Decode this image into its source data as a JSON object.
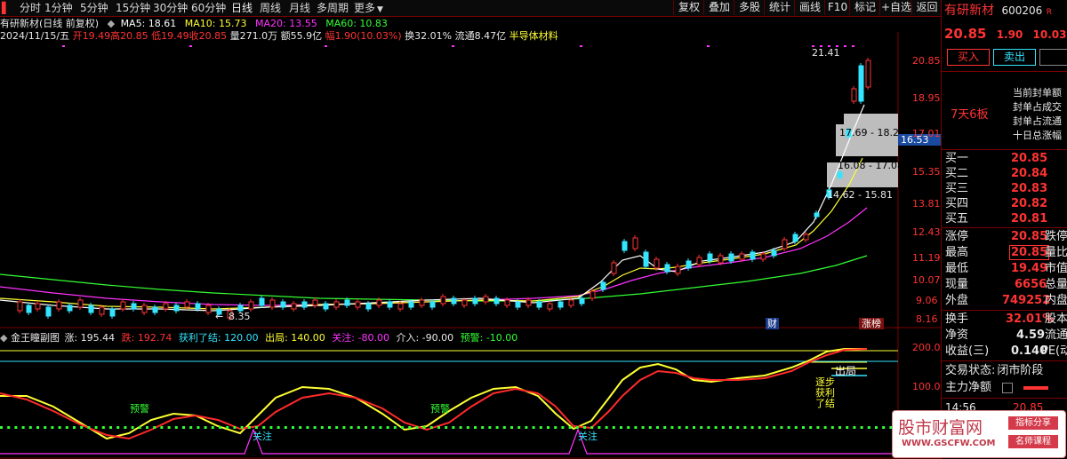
{
  "toolbar": {
    "periods": [
      "分时",
      "1分钟",
      "5分钟",
      "15分钟",
      "30分钟",
      "60分钟",
      "日线",
      "周线",
      "月线",
      "多周期",
      "更多"
    ],
    "active_period": "日线",
    "buttons": [
      "复权",
      "叠加",
      "多股",
      "统计",
      "画线",
      "F10",
      "标记",
      "+自选",
      "返回"
    ]
  },
  "header": {
    "title": "有研新材(日线 前复权)",
    "ma": [
      {
        "label": "MA5: 18.61",
        "color": "#ffffff"
      },
      {
        "label": "MA10: 15.73",
        "color": "#ffff33"
      },
      {
        "label": "MA20: 13.55",
        "color": "#ff33ff"
      },
      {
        "label": "MA60: 10.83",
        "color": "#33ff33"
      }
    ],
    "info_date": "2024/11/15/五",
    "info": [
      {
        "text": "开19.49",
        "color": "#ff3333"
      },
      {
        "text": "高20.85",
        "color": "#ff3333"
      },
      {
        "text": "低19.49",
        "color": "#ff3333"
      },
      {
        "text": "收20.85",
        "color": "#ff3333"
      },
      {
        "text": "量271.0万",
        "color": "#e8e8e8"
      },
      {
        "text": "额55.9亿",
        "color": "#e8e8e8"
      },
      {
        "text": "幅1.90(10.03%)",
        "color": "#ff3333"
      },
      {
        "text": "换32.01%",
        "color": "#e8e8e8"
      },
      {
        "text": "流通8.47亿",
        "color": "#e8e8e8"
      },
      {
        "text": "半导体材料",
        "color": "#ffff33"
      }
    ]
  },
  "price_axis": [
    "20.85",
    "18.95",
    "17.01",
    "15.35",
    "13.81",
    "12.43",
    "11.19",
    "10.07",
    "9.06",
    "8.16"
  ],
  "current_price_tag": "16.53",
  "annotations": {
    "high": "21.41",
    "low": "8.35",
    "range1": "17.69 - 18.2",
    "range2": "16.08 - 17.08",
    "range3": "14.62 - 15.81",
    "cai": "财",
    "zhangbang": "涨榜"
  },
  "indicator": {
    "name": "金王瞳副图",
    "values": [
      {
        "text": "涨: 195.44",
        "color": "#e8e8e8"
      },
      {
        "text": "跌: 192.74",
        "color": "#ff3333"
      },
      {
        "text": "获利了结: 120.00",
        "color": "#33e5ff"
      },
      {
        "text": "出局: 140.00",
        "color": "#ffff33"
      },
      {
        "text": "关注: -80.00",
        "color": "#ff33ff"
      },
      {
        "text": "介入: -90.00",
        "color": "#e8e8e8"
      },
      {
        "text": "预警: -10.00",
        "color": "#33ff33"
      }
    ],
    "axis": [
      "200.0",
      "100.0"
    ],
    "labels": {
      "yujing1": "预警",
      "yujing2": "预警",
      "guanzhu1": "关注",
      "guanzhu2": "关注",
      "chuju": "出局",
      "zhubu": "逐步",
      "huoli": "获利",
      "liaojie": "了结"
    }
  },
  "right_panel": {
    "name": "有研新材",
    "code": "600206",
    "code_suffix": "R",
    "price": "20.85",
    "change": "1.90",
    "pct": "10.03%",
    "buy_btn": "买入",
    "sell_btn": "卖出",
    "streak": "7天6板",
    "seal_info": [
      "当前封单额",
      "封单占成交",
      "封单占流通",
      "十日总涨幅"
    ],
    "bids": [
      {
        "label": "买一",
        "price": "20.85"
      },
      {
        "label": "买二",
        "price": "20.84"
      },
      {
        "label": "买三",
        "price": "20.83"
      },
      {
        "label": "买四",
        "price": "20.82"
      },
      {
        "label": "买五",
        "price": "20.81"
      }
    ],
    "stats": [
      {
        "label": "涨停",
        "value": "20.85",
        "label2": "跌停"
      },
      {
        "label": "最高",
        "value": "20.85",
        "label2": "量比"
      },
      {
        "label": "最低",
        "value": "19.49",
        "label2": "市值"
      },
      {
        "label": "现量",
        "value": "6656",
        "label2": "总量"
      },
      {
        "label": "外盘",
        "value": "749252",
        "label2": "内盘"
      }
    ],
    "stats2": [
      {
        "label": "换手",
        "value": "32.01%",
        "label2": "股本"
      },
      {
        "label": "净资",
        "value": "4.59",
        "label2": "流通"
      },
      {
        "label": "收益(三)",
        "value": "0.140",
        "label2": "PE(动"
      }
    ],
    "trade_status_label": "交易状态:",
    "trade_status": "闭市阶段",
    "main_flow": "主力净额",
    "time": "14:56",
    "time_price": "20.85"
  },
  "watermark": {
    "title": "股市财富网",
    "url": "WWW.GSCFW.COM",
    "tag1": "指标分享",
    "tag2": "名师课程"
  }
}
